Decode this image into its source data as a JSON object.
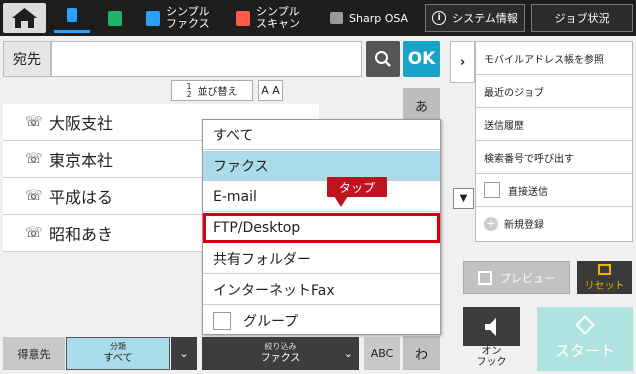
{
  "topbar": {
    "simple_fax": "シンプル\nファクス",
    "simple_scan": "シンプル\nスキャン",
    "sharp_osa": "Sharp OSA",
    "system_info": "システム情報",
    "job_status": "ジョブ状況"
  },
  "address": {
    "dest_label": "宛先",
    "dest_value": "",
    "ok_label": "OK",
    "sort_label": "並び替え",
    "sort_num": "1\n2",
    "font_label": "A A"
  },
  "contacts": [
    {
      "name": "大阪支社"
    },
    {
      "name": "東京本社"
    },
    {
      "name": "平成はる"
    },
    {
      "name": "昭和あき"
    }
  ],
  "kana": {
    "top": "あ",
    "bottom": "わ"
  },
  "dropdown": {
    "items": [
      {
        "label": "すべて"
      },
      {
        "label": "ファクス"
      },
      {
        "label": "E-mail"
      },
      {
        "label": "FTP/Desktop"
      },
      {
        "label": "共有フォルダー"
      },
      {
        "label": "インターネットFax"
      },
      {
        "label": "グループ"
      }
    ],
    "selected_index": 1,
    "highlighted_index": 3
  },
  "callout": {
    "text": "タップ"
  },
  "right_panel": {
    "actions": [
      {
        "label": "モバイルアドレス帳を参照"
      },
      {
        "label": "最近のジョブ"
      },
      {
        "label": "送信履歴"
      },
      {
        "label": "検索番号で呼び出す"
      },
      {
        "label": "直接送信"
      },
      {
        "label": "新規登録"
      }
    ],
    "preview": "プレビュー",
    "reset": "リセット",
    "onhook": "オン\nフック",
    "start": "スタート"
  },
  "bottom": {
    "favorites": "得意先",
    "category_caption": "分類",
    "category_value": "すべて",
    "filter_caption": "絞り込み",
    "filter_value": "ファクス",
    "abc": "ABC"
  },
  "colors": {
    "accent": "#1aa3c8",
    "selected": "#a9dbea",
    "highlight": "#d7000f",
    "topbar": "#1e1e1e"
  }
}
